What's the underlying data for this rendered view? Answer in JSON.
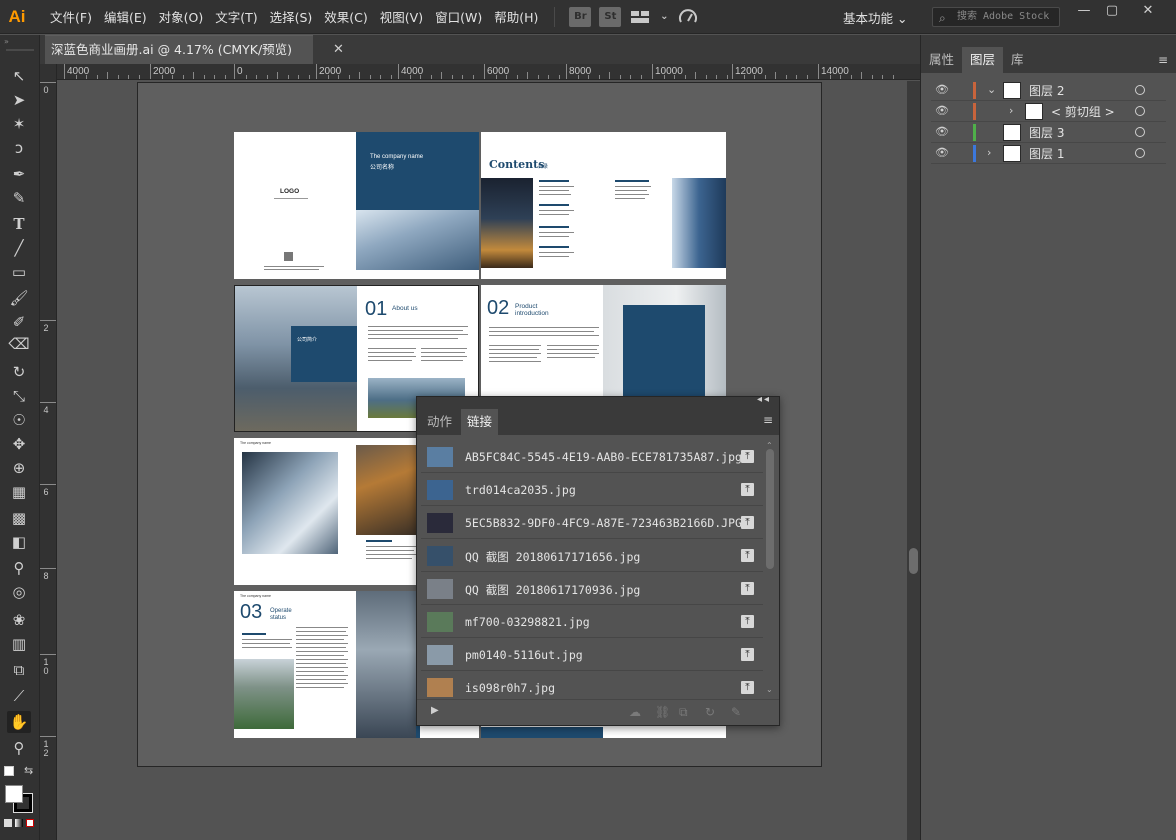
{
  "app": {
    "logo": "Ai"
  },
  "menu": {
    "items": [
      "文件(F)",
      "编辑(E)",
      "对象(O)",
      "文字(T)",
      "选择(S)",
      "效果(C)",
      "视图(V)",
      "窗口(W)",
      "帮助(H)"
    ],
    "bridge_label": "Br",
    "stock_label": "St",
    "workspace": "基本功能 ⌄",
    "search_placeholder": "搜索 Adobe Stock"
  },
  "window_controls": {
    "minimize": "—",
    "maximize": "▢",
    "close": "✕"
  },
  "document": {
    "tab_title": "深蓝色商业画册.ai @ 4.17% (CMYK/预览)",
    "close": "✕"
  },
  "ruler": {
    "top_labels": [
      "4000",
      "2000",
      "0",
      "2000",
      "4000",
      "6000",
      "8000",
      "10000",
      "12000",
      "14000"
    ],
    "left_labels": [
      "0",
      "2",
      "4",
      "6",
      "8",
      "1 0",
      "1 2"
    ]
  },
  "brochure": {
    "logo": "LOGO",
    "company_name": "The company name",
    "company_cn": "公司名称",
    "contents": "Contents",
    "contents_cn": "目录",
    "section1_num": "01",
    "section1_title": "About us",
    "section2_num": "02",
    "section2_title1": "Product",
    "section2_title2": "introduction",
    "section3_num": "03",
    "section3_title1": "Operate",
    "section3_title2": "status",
    "profile_cn": "公司简介"
  },
  "panels": {
    "right_tabs": [
      "属性",
      "图层",
      "库"
    ],
    "menu_icon": "≡",
    "layers": [
      {
        "name": "图层 2",
        "color": "#c8643c",
        "expanded": true
      },
      {
        "name": "< 剪切组 >",
        "color": "#c8643c",
        "expanded": false
      },
      {
        "name": "图层 3",
        "color": "#4fb04a",
        "expanded": false
      },
      {
        "name": "图层 1",
        "color": "#3c78dc",
        "expanded": false
      }
    ]
  },
  "links_panel": {
    "collapse": "◂◂",
    "tabs": [
      "动作",
      "链接"
    ],
    "menu_icon": "≡",
    "links": [
      "AB5FC84C-5545-4E19-AAB0-ECE781735A87.jpg",
      "trd014ca2035.jpg",
      "5EC5B832-9DF0-4FC9-A87E-723463B2166D.JPG",
      "QQ 截图 20180617171656.jpg",
      "QQ 截图 20180617170936.jpg",
      "mf700-03298821.jpg",
      "pm0140-5116ut.jpg",
      "is098r0h7.jpg"
    ]
  }
}
